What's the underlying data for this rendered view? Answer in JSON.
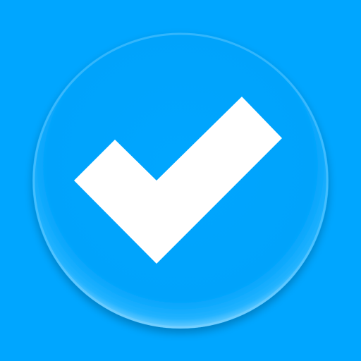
{
  "icon": {
    "name": "checkmark-icon",
    "background_color": "#00A6FF",
    "badge_color": "#00A2F8",
    "check_color": "#FFFFFF"
  }
}
